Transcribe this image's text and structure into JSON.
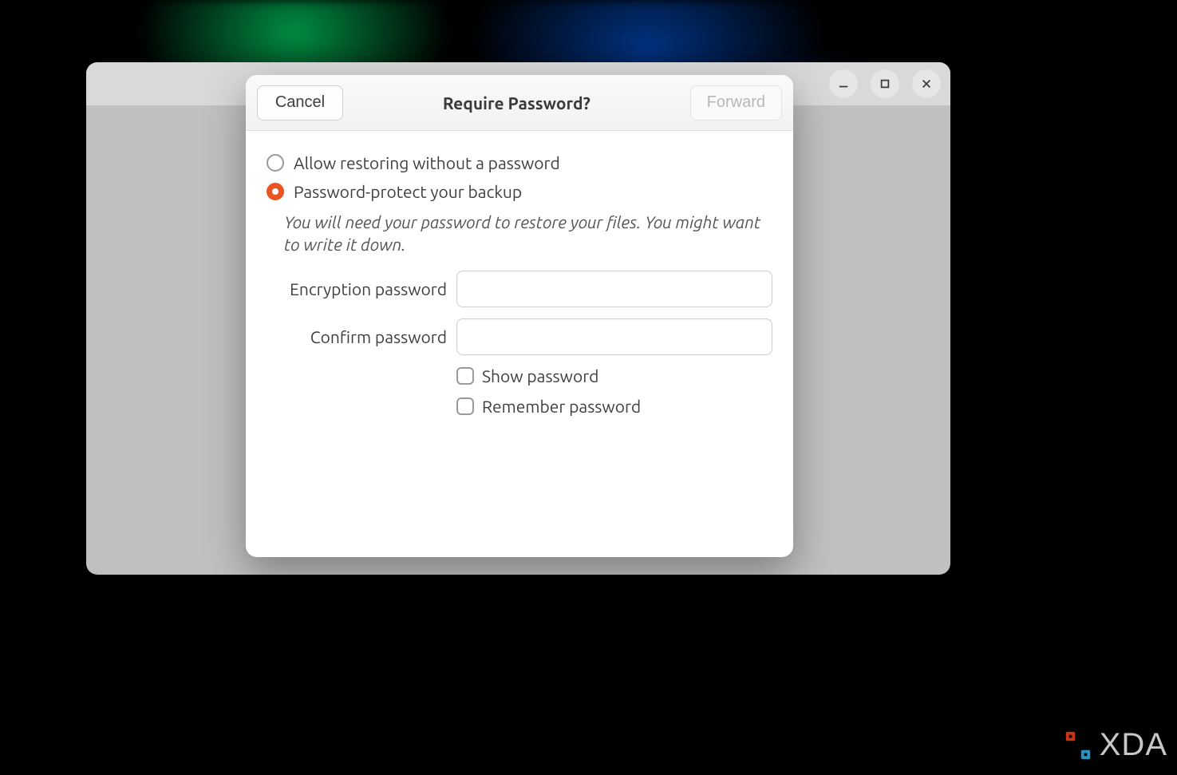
{
  "dialog": {
    "title": "Require Password?",
    "cancel_label": "Cancel",
    "forward_label": "Forward",
    "forward_enabled": false,
    "options": {
      "allow": {
        "label": "Allow restoring without a password",
        "selected": false
      },
      "protect": {
        "label": "Password-protect your backup",
        "selected": true
      }
    },
    "hint": "You will need your password to restore your files. You might want to write it down.",
    "fields": {
      "encryption": {
        "label": "Encryption password",
        "value": ""
      },
      "confirm": {
        "label": "Confirm password",
        "value": ""
      }
    },
    "checks": {
      "show": {
        "label": "Show password",
        "checked": false
      },
      "remember": {
        "label": "Remember password",
        "checked": false
      }
    }
  },
  "watermark": {
    "text": "XDA"
  },
  "colors": {
    "accent": "#e95420"
  }
}
